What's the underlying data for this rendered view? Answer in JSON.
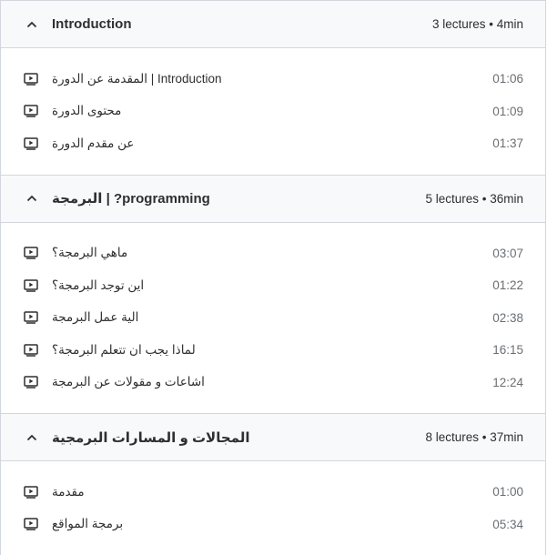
{
  "sections": [
    {
      "title": "Introduction",
      "meta": "3 lectures • 4min",
      "lectures": [
        {
          "title": "المقدمة عن الدورة | Introduction",
          "duration": "01:06"
        },
        {
          "title": "محتوى الدورة",
          "duration": "01:09"
        },
        {
          "title": "عن مقدم الدورة",
          "duration": "01:37"
        }
      ]
    },
    {
      "title": "البرمجة | ?programming",
      "meta": "5 lectures • 36min",
      "lectures": [
        {
          "title": "ماهي البرمجة؟",
          "duration": "03:07"
        },
        {
          "title": "اين توجد البرمجة؟",
          "duration": "01:22"
        },
        {
          "title": "الية عمل البرمجة",
          "duration": "02:38"
        },
        {
          "title": "لماذا يجب ان تتعلم البرمجة؟",
          "duration": "16:15"
        },
        {
          "title": "اشاعات و مقولات عن البرمجة",
          "duration": "12:24"
        }
      ]
    },
    {
      "title": "المجالات و المسارات البرمجية",
      "meta": "8 lectures • 37min",
      "lectures": [
        {
          "title": "مقدمة",
          "duration": "01:00"
        },
        {
          "title": "برمجة المواقع",
          "duration": "05:34"
        }
      ]
    }
  ],
  "icons": {
    "section_toggle": "chevron-up-icon",
    "lecture": "video-play-icon"
  }
}
